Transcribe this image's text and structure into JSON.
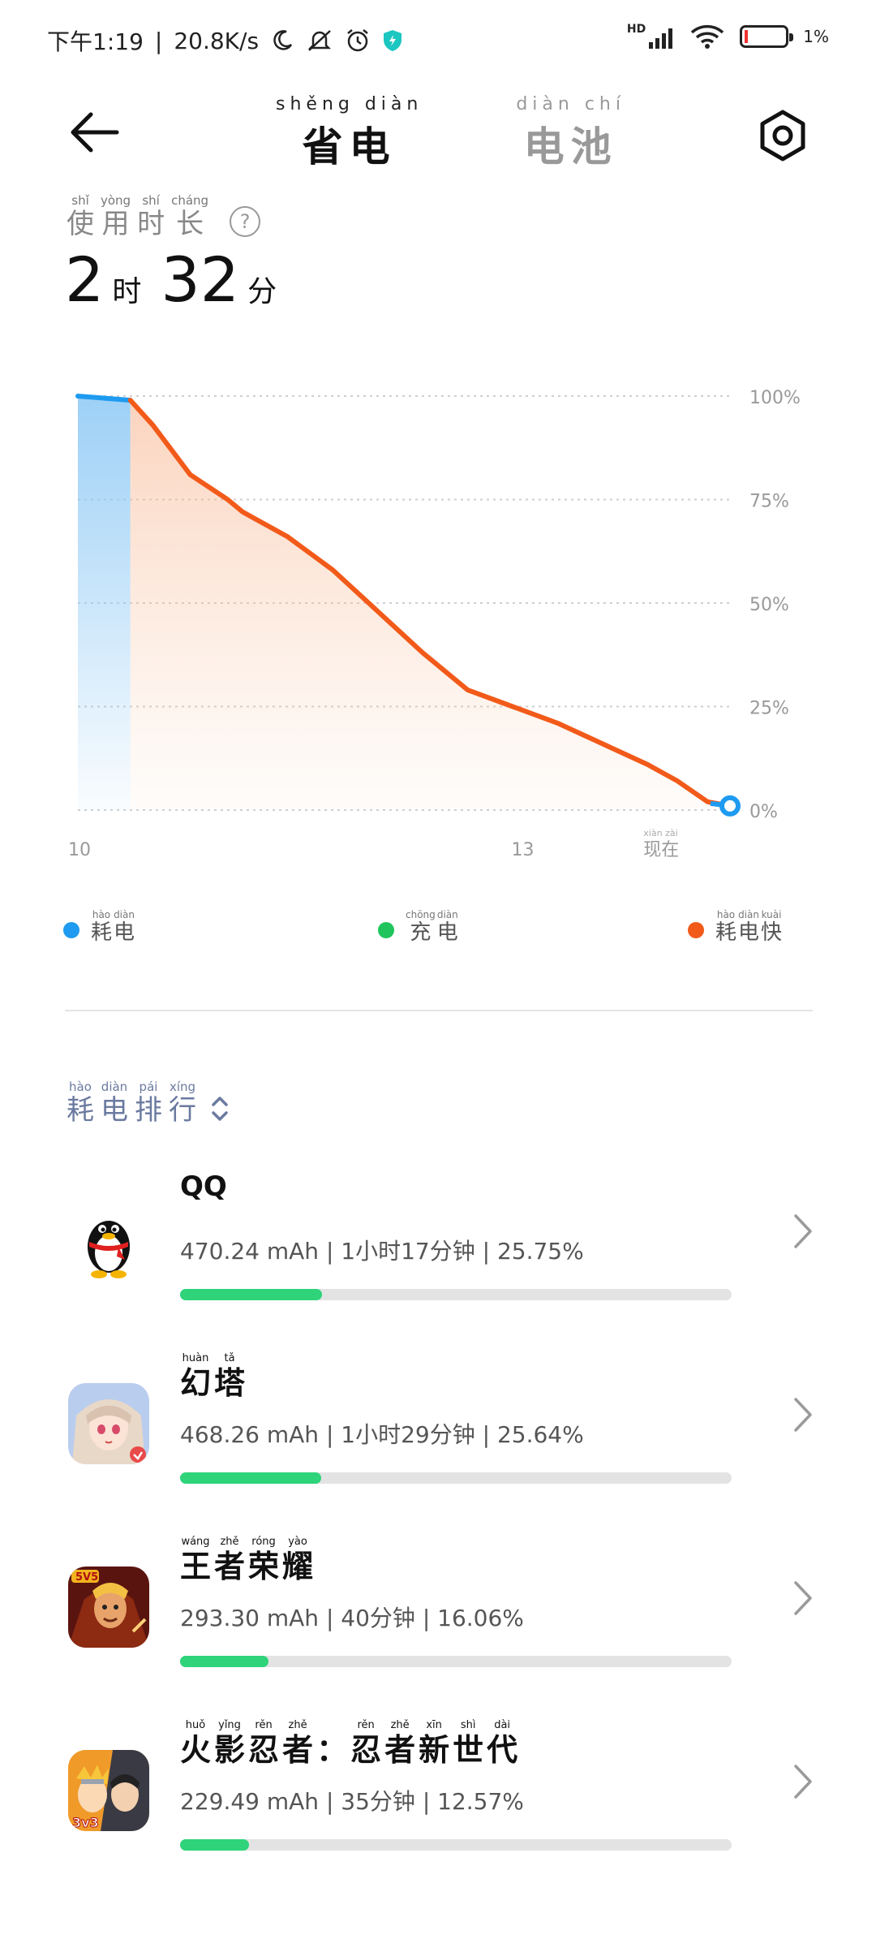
{
  "status_bar": {
    "time": "下午1:19",
    "net_speed": "20.8K/s",
    "network": "HD",
    "battery": "1%"
  },
  "header": {
    "tab_active": {
      "label": "省电",
      "pinyin": "shěng diàn"
    },
    "tab_inactive": {
      "label": "电池",
      "pinyin": "diàn chí"
    }
  },
  "usage": {
    "label_chars": [
      {
        "hz": "使",
        "py": "shǐ"
      },
      {
        "hz": "用",
        "py": "yòng"
      },
      {
        "hz": "时",
        "py": "shí"
      },
      {
        "hz": "长",
        "py": "cháng"
      }
    ],
    "hours": "2",
    "hours_unit": "时",
    "minutes": "32",
    "minutes_unit": "分"
  },
  "chart_data": {
    "type": "area",
    "x_ticks": [
      "10",
      "13",
      "现在"
    ],
    "x_ticks_pinyin": {
      "现在": "xiàn zài"
    },
    "y_ticks": [
      "100%",
      "75%",
      "50%",
      "25%",
      "0%"
    ],
    "ylim": [
      0,
      100
    ],
    "xlim": [
      10,
      14.0
    ],
    "series": [
      {
        "name": "耗电",
        "color": "#1e9bf0",
        "points": [
          [
            10.0,
            100
          ],
          [
            10.35,
            99
          ]
        ]
      },
      {
        "name": "耗电快",
        "color": "#f25a1a",
        "points": [
          [
            10.35,
            99
          ],
          [
            10.5,
            93
          ],
          [
            10.75,
            81
          ],
          [
            11.0,
            75
          ],
          [
            11.1,
            72
          ],
          [
            11.4,
            66
          ],
          [
            11.7,
            58
          ],
          [
            12.0,
            48
          ],
          [
            12.3,
            38
          ],
          [
            12.6,
            29
          ],
          [
            12.9,
            25
          ],
          [
            13.2,
            21
          ],
          [
            13.5,
            16
          ],
          [
            13.8,
            11
          ],
          [
            14.0,
            7
          ],
          [
            14.2,
            2
          ],
          [
            14.35,
            1
          ]
        ]
      }
    ]
  },
  "legend": [
    {
      "label": "耗电",
      "pinyin": [
        "hào",
        "diàn"
      ],
      "color": "#1e9bf0"
    },
    {
      "label": "充电",
      "pinyin": [
        "chōng",
        "diàn"
      ],
      "color": "#1fc55c"
    },
    {
      "label": "耗电快",
      "pinyin": [
        "hào",
        "diàn",
        "kuài"
      ],
      "color": "#f25a1a"
    }
  ],
  "ranking": {
    "title_chars": [
      {
        "hz": "耗",
        "py": "hào"
      },
      {
        "hz": "电",
        "py": "diàn"
      },
      {
        "hz": "排",
        "py": "pái"
      },
      {
        "hz": "行",
        "py": "xíng"
      }
    ],
    "apps": [
      {
        "name": "QQ",
        "name_chars": [],
        "stats": "470.24 mAh | 1小时17分钟 | 25.75%",
        "percent": 25.75
      },
      {
        "name": "幻塔",
        "name_chars": [
          {
            "hz": "幻",
            "py": "huàn"
          },
          {
            "hz": "塔",
            "py": "tǎ"
          }
        ],
        "stats": "468.26 mAh | 1小时29分钟 | 25.64%",
        "percent": 25.64
      },
      {
        "name": "王者荣耀",
        "name_chars": [
          {
            "hz": "王",
            "py": "wáng"
          },
          {
            "hz": "者",
            "py": "zhě"
          },
          {
            "hz": "荣",
            "py": "róng"
          },
          {
            "hz": "耀",
            "py": "yào"
          }
        ],
        "stats": "293.30 mAh | 40分钟 | 16.06%",
        "percent": 16.06
      },
      {
        "name": "火影忍者：忍者新世代",
        "name_chars": [
          {
            "hz": "火",
            "py": "huǒ"
          },
          {
            "hz": "影",
            "py": "yǐng"
          },
          {
            "hz": "忍",
            "py": "rěn"
          },
          {
            "hz": "者",
            "py": "zhě"
          },
          {
            "hz": "：",
            "py": ""
          },
          {
            "hz": "忍",
            "py": "rěn"
          },
          {
            "hz": "者",
            "py": "zhě"
          },
          {
            "hz": "新",
            "py": "xīn"
          },
          {
            "hz": "世",
            "py": "shì"
          },
          {
            "hz": "代",
            "py": "dài"
          }
        ],
        "stats": "229.49 mAh | 35分钟 | 12.57%",
        "percent": 12.57
      }
    ]
  }
}
